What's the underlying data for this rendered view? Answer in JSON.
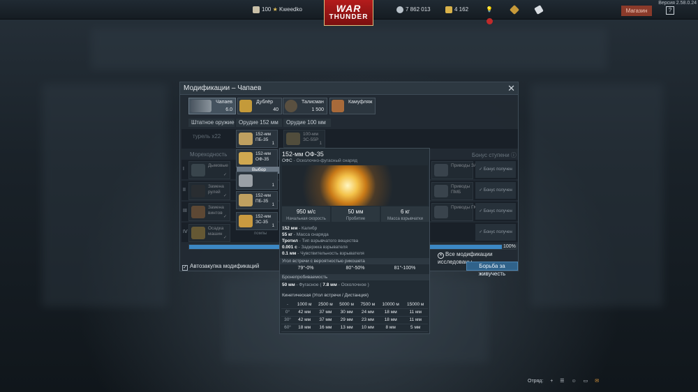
{
  "topbar": {
    "rank": "100",
    "player": "Kweedko",
    "logo_line1": "WAR",
    "logo_line2": "THUNDER",
    "silver": "7 862 013",
    "gold": "4 162",
    "shop": "Магазин",
    "help": "?",
    "version": "Версия 2.58.0.24"
  },
  "modal": {
    "title": "Модификации – Чапаев",
    "close": "✕",
    "slots": [
      {
        "name": "Чапаев",
        "sub": "6.0"
      },
      {
        "name": "Дублёр",
        "sub": "40"
      },
      {
        "name": "Талисман",
        "sub": "1 500"
      },
      {
        "name": "Камуфляж",
        "sub": ""
      }
    ],
    "columns": [
      "Штатное оружие",
      "Орудие 152 мм",
      "Орудие 100 мм"
    ],
    "standard_weapon": "турель x22",
    "col152": [
      {
        "name": "152-мм\nПБ-35",
        "count": "1"
      },
      {
        "name": "152-мм\nОФ-35",
        "count": ""
      },
      {
        "name": "152-мм\nПБ-35",
        "count": "1"
      },
      {
        "name": "152-мм\nПБ-35",
        "count": "1"
      },
      {
        "name": "152-мм\nЗС-35",
        "count": "1"
      }
    ],
    "col100": {
      "name": "100-мм\nЗС-55Р",
      "count": "1"
    },
    "seaworthiness": "Мореходность",
    "bonus_header": "Бонус ступени ⓘ",
    "row_numerals": [
      "I",
      "II",
      "III",
      "IV"
    ],
    "left_mods": [
      "Дымовые",
      "Замена\nрулей",
      "Замена\nвинтов",
      "Осадка\nмашин"
    ],
    "right_mods": [
      "Приводы ЗА",
      "Приводы\nПМБ",
      "Приводы ГК",
      ""
    ],
    "bonus_cells": [
      "✓ Бонус получен",
      "✓ Бонус получен",
      "✓ Бонус получен",
      "✓ Бонус получен"
    ],
    "hidden_label": "помпы",
    "select_label": "Выбор",
    "progress_pct": 100,
    "progress_label": "100%",
    "all_researched": "Все модификации исследованы",
    "autobuy": "Автозакупка модификаций",
    "survival_button": "Борьба за живучесть"
  },
  "tooltip": {
    "title": "152-мм ОФ-35",
    "subtitle_code": "ОФС",
    "subtitle_desc": " - Осколочно-фугасный снаряд",
    "stats": [
      {
        "value": "950 м/с",
        "label": "Начальная скорость"
      },
      {
        "value": "50 мм",
        "label": "Пробитие"
      },
      {
        "value": "6 кг",
        "label": "Масса взрывчатки"
      }
    ],
    "props": [
      {
        "value": "152 мм",
        "label": " - Калибр"
      },
      {
        "value": "55 кг",
        "label": " - Масса снаряда"
      },
      {
        "value": "Тротил",
        "label": " - Тип взрывчатого вещества"
      },
      {
        "value": "0.001 с",
        "label": " - Задержка взрывателя"
      },
      {
        "value": "0.1 мм",
        "label": " - Чувствительность взрывателя"
      }
    ],
    "ricochet_title": "Угол встречи с вероятностью рикошета",
    "ricochet": [
      "79°-0%",
      "80°-50%",
      "81°-100%"
    ],
    "armor_title": "Бронепробиваемость",
    "pen_value": "50 мм",
    "pen_fug": " - Фугасное ( ",
    "pen_frag_value": "7.8 мм",
    "pen_frag": " - Осколочное )",
    "kinetic_title": "Кинетическая (Угол встречи / Дистанция)",
    "table_header": [
      "-",
      "1000 м",
      "2500 м",
      "5000 м",
      "7500 м",
      "10000 м",
      "15000 м"
    ],
    "table_rows": [
      [
        "0°",
        "42 мм",
        "37 мм",
        "30 мм",
        "24 мм",
        "18 мм",
        "11 мм"
      ],
      [
        "30°",
        "42 мм",
        "37 мм",
        "29 мм",
        "23 мм",
        "18 мм",
        "11 мм"
      ],
      [
        "60°",
        "18 мм",
        "16 мм",
        "13 мм",
        "10 мм",
        "8 мм",
        "5 мм"
      ]
    ]
  },
  "bottombar": {
    "squad": "Отряд:",
    "add": "+"
  },
  "colors": {
    "accent_blue": "#3c88c4",
    "logo_red": "#b41c1c",
    "check_green": "#8fd07a"
  }
}
